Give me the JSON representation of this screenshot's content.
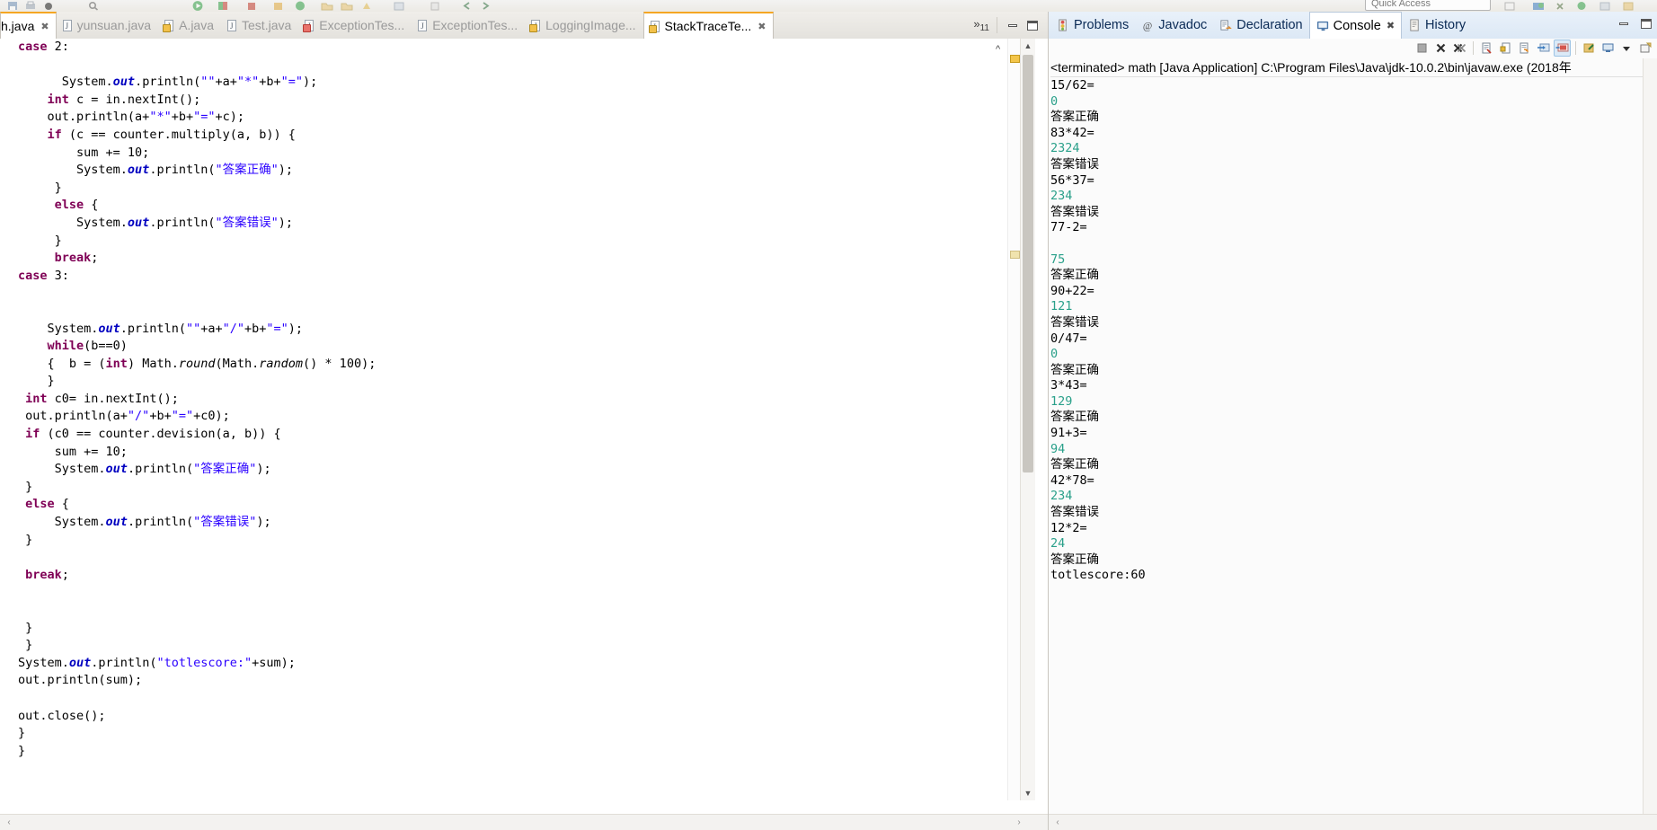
{
  "quick_access": {
    "label": "Quick Access"
  },
  "editor": {
    "tabs": [
      {
        "label": "h.java",
        "icon": "java-file-icon",
        "badge": "none",
        "active": true,
        "partial": true,
        "closeable": true
      },
      {
        "label": "yunsuan.java",
        "icon": "java-file-icon",
        "badge": "none",
        "active": false
      },
      {
        "label": "A.java",
        "icon": "java-file-warning-icon",
        "badge": "warn",
        "active": false
      },
      {
        "label": "Test.java",
        "icon": "java-file-icon",
        "badge": "none",
        "active": false
      },
      {
        "label": "ExceptionTes...",
        "icon": "java-file-error-icon",
        "badge": "err",
        "active": false
      },
      {
        "label": "ExceptionTes...",
        "icon": "java-file-icon",
        "badge": "none",
        "active": false
      },
      {
        "label": "LoggingImage...",
        "icon": "java-file-warning-icon",
        "badge": "warn",
        "active": false
      },
      {
        "label": "StackTraceTe...",
        "icon": "java-file-warning-icon",
        "badge": "warn",
        "active": true,
        "closeable": true
      }
    ],
    "overflow": {
      "chevron": "»",
      "count": "11"
    },
    "window_buttons": {
      "minimize": "Minimize",
      "maximize": "Maximize"
    },
    "code_lines": [
      [
        {
          "t": "case",
          "c": "kw"
        },
        {
          "t": " 2:",
          "c": "plain"
        }
      ],
      [],
      [
        {
          "t": "      System.",
          "c": "plain"
        },
        {
          "t": "out",
          "c": "fld"
        },
        {
          "t": ".println(",
          "c": "plain"
        },
        {
          "t": "\"\"",
          "c": "str"
        },
        {
          "t": "+a+",
          "c": "plain"
        },
        {
          "t": "\"*\"",
          "c": "str"
        },
        {
          "t": "+b+",
          "c": "plain"
        },
        {
          "t": "\"=\"",
          "c": "str"
        },
        {
          "t": ");",
          "c": "plain"
        }
      ],
      [
        {
          "t": "    ",
          "c": "plain"
        },
        {
          "t": "int",
          "c": "kw"
        },
        {
          "t": " c = in.nextInt();",
          "c": "plain"
        }
      ],
      [
        {
          "t": "    out.println(a+",
          "c": "plain"
        },
        {
          "t": "\"*\"",
          "c": "str"
        },
        {
          "t": "+b+",
          "c": "plain"
        },
        {
          "t": "\"=\"",
          "c": "str"
        },
        {
          "t": "+c);",
          "c": "plain"
        }
      ],
      [
        {
          "t": "    ",
          "c": "plain"
        },
        {
          "t": "if",
          "c": "kw"
        },
        {
          "t": " (c == counter.multiply(a, b)) {",
          "c": "plain"
        }
      ],
      [
        {
          "t": "        sum += 10;",
          "c": "plain"
        }
      ],
      [
        {
          "t": "        System.",
          "c": "plain"
        },
        {
          "t": "out",
          "c": "fld"
        },
        {
          "t": ".println(",
          "c": "plain"
        },
        {
          "t": "\"答案正确\"",
          "c": "str"
        },
        {
          "t": ");",
          "c": "plain"
        }
      ],
      [
        {
          "t": "     }",
          "c": "plain"
        }
      ],
      [
        {
          "t": "     ",
          "c": "plain"
        },
        {
          "t": "else",
          "c": "kw"
        },
        {
          "t": " {",
          "c": "plain"
        }
      ],
      [
        {
          "t": "        System.",
          "c": "plain"
        },
        {
          "t": "out",
          "c": "fld"
        },
        {
          "t": ".println(",
          "c": "plain"
        },
        {
          "t": "\"答案错误\"",
          "c": "str"
        },
        {
          "t": ");",
          "c": "plain"
        }
      ],
      [
        {
          "t": "     }",
          "c": "plain"
        }
      ],
      [
        {
          "t": "     ",
          "c": "plain"
        },
        {
          "t": "break",
          "c": "kw"
        },
        {
          "t": ";",
          "c": "plain"
        }
      ],
      [
        {
          "t": "case",
          "c": "kw"
        },
        {
          "t": " 3:",
          "c": "plain"
        }
      ],
      [],
      [],
      [
        {
          "t": "    System.",
          "c": "plain"
        },
        {
          "t": "out",
          "c": "fld"
        },
        {
          "t": ".println(",
          "c": "plain"
        },
        {
          "t": "\"\"",
          "c": "str"
        },
        {
          "t": "+a+",
          "c": "plain"
        },
        {
          "t": "\"/\"",
          "c": "str"
        },
        {
          "t": "+b+",
          "c": "plain"
        },
        {
          "t": "\"=\"",
          "c": "str"
        },
        {
          "t": ");",
          "c": "plain"
        }
      ],
      [
        {
          "t": "    ",
          "c": "plain"
        },
        {
          "t": "while",
          "c": "kw"
        },
        {
          "t": "(b==0)",
          "c": "plain"
        }
      ],
      [
        {
          "t": "    {  b = (",
          "c": "plain"
        },
        {
          "t": "int",
          "c": "kw"
        },
        {
          "t": ") Math.",
          "c": "plain"
        },
        {
          "t": "round",
          "c": "mth"
        },
        {
          "t": "(Math.",
          "c": "plain"
        },
        {
          "t": "random",
          "c": "mth"
        },
        {
          "t": "() * 100);",
          "c": "plain"
        }
      ],
      [
        {
          "t": "    }",
          "c": "plain"
        }
      ],
      [
        {
          "t": " ",
          "c": "plain"
        },
        {
          "t": "int",
          "c": "kw"
        },
        {
          "t": " c0= in.nextInt();",
          "c": "plain"
        }
      ],
      [
        {
          "t": " out.println(a+",
          "c": "plain"
        },
        {
          "t": "\"/\"",
          "c": "str"
        },
        {
          "t": "+b+",
          "c": "plain"
        },
        {
          "t": "\"=\"",
          "c": "str"
        },
        {
          "t": "+c0);",
          "c": "plain"
        }
      ],
      [
        {
          "t": " ",
          "c": "plain"
        },
        {
          "t": "if",
          "c": "kw"
        },
        {
          "t": " (c0 == counter.devision(a, b)) {",
          "c": "plain"
        }
      ],
      [
        {
          "t": "     sum += 10;",
          "c": "plain"
        }
      ],
      [
        {
          "t": "     System.",
          "c": "plain"
        },
        {
          "t": "out",
          "c": "fld"
        },
        {
          "t": ".println(",
          "c": "plain"
        },
        {
          "t": "\"答案正确\"",
          "c": "str"
        },
        {
          "t": ");",
          "c": "plain"
        }
      ],
      [
        {
          "t": " }",
          "c": "plain"
        }
      ],
      [
        {
          "t": " ",
          "c": "plain"
        },
        {
          "t": "else",
          "c": "kw"
        },
        {
          "t": " {",
          "c": "plain"
        }
      ],
      [
        {
          "t": "     System.",
          "c": "plain"
        },
        {
          "t": "out",
          "c": "fld"
        },
        {
          "t": ".println(",
          "c": "plain"
        },
        {
          "t": "\"答案错误\"",
          "c": "str"
        },
        {
          "t": ");",
          "c": "plain"
        }
      ],
      [
        {
          "t": " }",
          "c": "plain"
        }
      ],
      [],
      [
        {
          "t": " ",
          "c": "plain"
        },
        {
          "t": "break",
          "c": "kw"
        },
        {
          "t": ";",
          "c": "plain"
        }
      ],
      [],
      [],
      [
        {
          "t": " }",
          "c": "plain"
        }
      ],
      [
        {
          "t": " }",
          "c": "plain"
        }
      ],
      [
        {
          "t": "System.",
          "c": "plain"
        },
        {
          "t": "out",
          "c": "fld"
        },
        {
          "t": ".println(",
          "c": "plain"
        },
        {
          "t": "\"totlescore:\"",
          "c": "str"
        },
        {
          "t": "+sum);",
          "c": "plain"
        }
      ],
      [
        {
          "t": "out.println(sum);",
          "c": "plain"
        }
      ],
      [],
      [
        {
          "t": "out.close();",
          "c": "plain"
        }
      ],
      [
        {
          "t": "}",
          "c": "plain"
        }
      ],
      [
        {
          "t": "}",
          "c": "plain"
        }
      ]
    ],
    "hscroll": {
      "left_arrow": "‹",
      "right_arrow": "›"
    },
    "vscroll": {
      "up_arrow": "▲",
      "down_arrow": "▼"
    }
  },
  "console_view": {
    "tabs": [
      {
        "label": "Problems",
        "icon": "problems-icon",
        "active": false
      },
      {
        "label": "Javadoc",
        "icon": "javadoc-at-icon",
        "active": false
      },
      {
        "label": "Declaration",
        "icon": "declaration-icon",
        "active": false
      },
      {
        "label": "Console",
        "icon": "console-icon",
        "active": true,
        "closeable": true
      },
      {
        "label": "History",
        "icon": "history-icon",
        "active": false
      }
    ],
    "toolbar_buttons": [
      {
        "name": "terminate-button",
        "title": "Terminate"
      },
      {
        "name": "remove-launch-button",
        "title": "Remove Launch"
      },
      {
        "name": "remove-all-terminated-button",
        "title": "Remove All Terminated Launches"
      },
      {
        "name": "clear-console-button",
        "title": "Clear Console"
      },
      {
        "name": "scroll-lock-button",
        "title": "Scroll Lock"
      },
      {
        "name": "word-wrap-button",
        "title": "Word Wrap"
      },
      {
        "name": "show-console-on-output-button",
        "title": "Show Console When Standard Out Changes"
      },
      {
        "name": "show-console-on-error-button",
        "title": "Show Console When Standard Error Changes",
        "selected": true
      },
      {
        "name": "pin-console-button",
        "title": "Pin Console"
      },
      {
        "name": "display-selected-console-button",
        "title": "Display Selected Console"
      },
      {
        "name": "open-console-dropdown",
        "title": "Open Console"
      },
      {
        "name": "new-console-view-button",
        "title": "New Console View"
      }
    ],
    "header": "<terminated> math [Java Application] C:\\Program Files\\Java\\jdk-10.0.2\\bin\\javaw.exe (2018年",
    "output": [
      {
        "text": "15/62=",
        "kind": "std"
      },
      {
        "text": "0",
        "kind": "in"
      },
      {
        "text": "答案正确",
        "kind": "std"
      },
      {
        "text": "83*42=",
        "kind": "std"
      },
      {
        "text": "2324",
        "kind": "in"
      },
      {
        "text": "答案错误",
        "kind": "std"
      },
      {
        "text": "56*37=",
        "kind": "std"
      },
      {
        "text": "234",
        "kind": "in"
      },
      {
        "text": "答案错误",
        "kind": "std"
      },
      {
        "text": "77-2=",
        "kind": "std"
      },
      {
        "text": "",
        "kind": "std"
      },
      {
        "text": "75",
        "kind": "in"
      },
      {
        "text": "答案正确",
        "kind": "std"
      },
      {
        "text": "90+22=",
        "kind": "std"
      },
      {
        "text": "121",
        "kind": "in"
      },
      {
        "text": "答案错误",
        "kind": "std"
      },
      {
        "text": "0/47=",
        "kind": "std"
      },
      {
        "text": "0",
        "kind": "in"
      },
      {
        "text": "答案正确",
        "kind": "std"
      },
      {
        "text": "3*43=",
        "kind": "std"
      },
      {
        "text": "129",
        "kind": "in"
      },
      {
        "text": "答案正确",
        "kind": "std"
      },
      {
        "text": "91+3=",
        "kind": "std"
      },
      {
        "text": "94",
        "kind": "in"
      },
      {
        "text": "答案正确",
        "kind": "std"
      },
      {
        "text": "42*78=",
        "kind": "std"
      },
      {
        "text": "234",
        "kind": "in"
      },
      {
        "text": "答案错误",
        "kind": "std"
      },
      {
        "text": "12*2=",
        "kind": "std"
      },
      {
        "text": "24",
        "kind": "in"
      },
      {
        "text": "答案正确",
        "kind": "std",
        "cursor": true
      },
      {
        "text": "totlescore:60",
        "kind": "std"
      }
    ],
    "hscroll": {
      "left_arrow": "‹"
    },
    "window_buttons": {
      "minimize": "Minimize",
      "maximize": "Maximize"
    }
  },
  "colors": {
    "keyword": "#7f0055",
    "string": "#2a00ff",
    "field": "#0000c0",
    "console_stdin": "#2aa08a",
    "tab_active_top": "#f5a623"
  }
}
